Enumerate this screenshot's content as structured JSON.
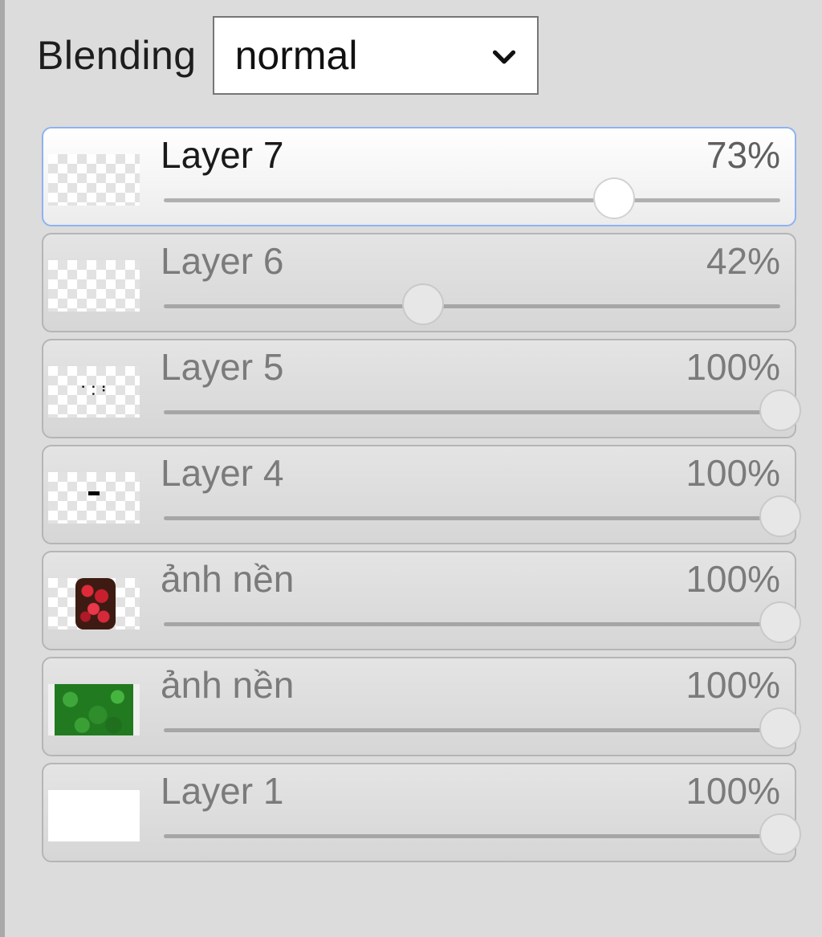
{
  "blending": {
    "label": "Blending",
    "selected": "normal"
  },
  "layers": [
    {
      "name": "Layer 7",
      "opacity_label": "73%",
      "opacity": 0.73,
      "active": true,
      "thumb": "transparent"
    },
    {
      "name": "Layer 6",
      "opacity_label": "42%",
      "opacity": 0.42,
      "active": false,
      "thumb": "transparent"
    },
    {
      "name": "Layer 5",
      "opacity_label": "100%",
      "opacity": 1.0,
      "active": false,
      "thumb": "specks"
    },
    {
      "name": "Layer 4",
      "opacity_label": "100%",
      "opacity": 1.0,
      "active": false,
      "thumb": "mark"
    },
    {
      "name": "ảnh nền",
      "opacity_label": "100%",
      "opacity": 1.0,
      "active": false,
      "thumb": "red-image"
    },
    {
      "name": "ảnh nền",
      "opacity_label": "100%",
      "opacity": 1.0,
      "active": false,
      "thumb": "green-image"
    },
    {
      "name": "Layer 1",
      "opacity_label": "100%",
      "opacity": 1.0,
      "active": false,
      "thumb": "white"
    }
  ]
}
